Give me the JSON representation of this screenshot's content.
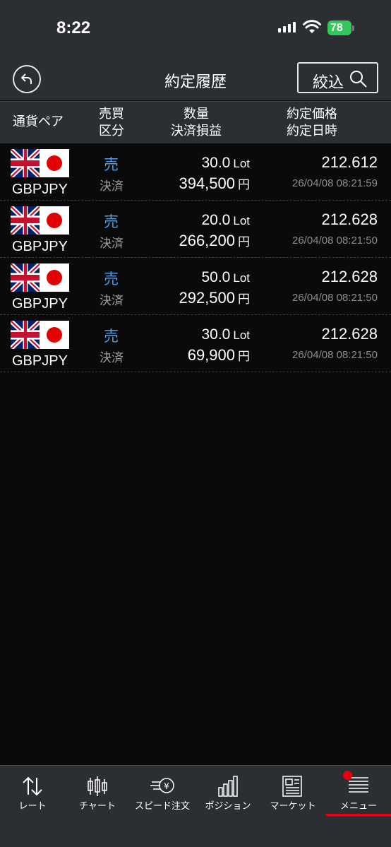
{
  "status": {
    "time": "8:22",
    "battery": "78"
  },
  "nav": {
    "title": "約定履歴",
    "filter_label": "絞込"
  },
  "columns": {
    "pair": "通貨ペア",
    "side_line1": "売買",
    "side_line2": "区分",
    "qty_line1": "数量",
    "qty_line2": "決済損益",
    "price_line1": "約定価格",
    "price_line2": "約定日時"
  },
  "rows": [
    {
      "pair": "GBPJPY",
      "side": "売",
      "kind": "決済",
      "qty": "30.0",
      "qty_unit": "Lot",
      "pl": "394,500",
      "pl_unit": "円",
      "price": "212.612",
      "datetime": "26/04/08 08:21:59"
    },
    {
      "pair": "GBPJPY",
      "side": "売",
      "kind": "決済",
      "qty": "20.0",
      "qty_unit": "Lot",
      "pl": "266,200",
      "pl_unit": "円",
      "price": "212.628",
      "datetime": "26/04/08 08:21:50"
    },
    {
      "pair": "GBPJPY",
      "side": "売",
      "kind": "決済",
      "qty": "50.0",
      "qty_unit": "Lot",
      "pl": "292,500",
      "pl_unit": "円",
      "price": "212.628",
      "datetime": "26/04/08 08:21:50"
    },
    {
      "pair": "GBPJPY",
      "side": "売",
      "kind": "決済",
      "qty": "30.0",
      "qty_unit": "Lot",
      "pl": "69,900",
      "pl_unit": "円",
      "price": "212.628",
      "datetime": "26/04/08 08:21:50"
    }
  ],
  "tabs": [
    {
      "label": "レート",
      "icon": "rate-arrows-icon"
    },
    {
      "label": "チャート",
      "icon": "candlestick-icon"
    },
    {
      "label": "スピード注文",
      "icon": "speed-order-icon"
    },
    {
      "label": "ポジション",
      "icon": "position-bars-icon"
    },
    {
      "label": "マーケット",
      "icon": "news-icon"
    },
    {
      "label": "メニュー",
      "icon": "menu-icon"
    }
  ],
  "colors": {
    "accent_red": "#e60012",
    "sell_blue": "#4b9de8",
    "bar_bg": "#2b2e32",
    "bg": "#0a0a0a"
  }
}
